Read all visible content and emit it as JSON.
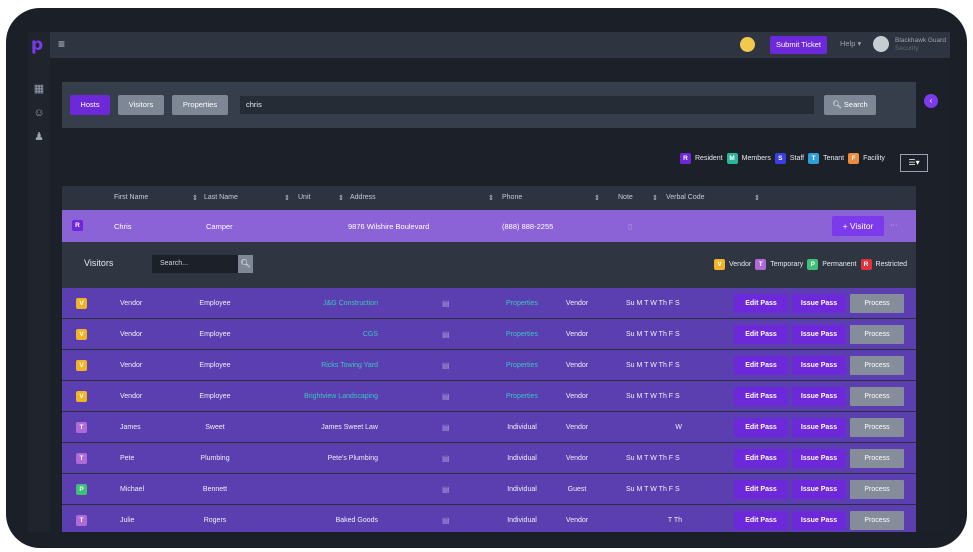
{
  "colors": {
    "accent": "#7c3aed",
    "resident": "#6d28d9",
    "members": "#2bb59a",
    "staff": "#3b3fe0",
    "tenant": "#2f9fd8",
    "facility": "#f08a3c",
    "vendor": "#f0b429",
    "temporary": "#b06ad8",
    "permanent": "#3fbf78",
    "restricted": "#e0323c"
  },
  "topbar": {
    "submit_label": "Submit Ticket",
    "help_label": "Help",
    "user_name": "Blackhawk Guard",
    "user_role": "Security"
  },
  "search": {
    "tabs": [
      "Hosts",
      "Visitors",
      "Properties"
    ],
    "query": "chris",
    "button_label": "Search"
  },
  "legend": [
    {
      "letter": "R",
      "label": "Resident"
    },
    {
      "letter": "M",
      "label": "Members"
    },
    {
      "letter": "S",
      "label": "Staff"
    },
    {
      "letter": "T",
      "label": "Tenant"
    },
    {
      "letter": "F",
      "label": "Facility"
    }
  ],
  "host_columns": [
    "First Name",
    "Last Name",
    "Unit",
    "Address",
    "Phone",
    "Note",
    "Verbal Code"
  ],
  "host": {
    "badge": "R",
    "first": "Chris",
    "last": "Camper",
    "address": "9876 Wilshire Boulevard",
    "phone": "(888) 888-2255",
    "add_label": "+ Visitor",
    "more": "···"
  },
  "visitors_panel": {
    "title": "Visitors",
    "search_placeholder": "Search..."
  },
  "visitor_legend": [
    {
      "letter": "V",
      "label": "Vendor"
    },
    {
      "letter": "T",
      "label": "Temporary"
    },
    {
      "letter": "P",
      "label": "Permanent"
    },
    {
      "letter": "R",
      "label": "Restricted"
    }
  ],
  "visitors": [
    {
      "badge": "V",
      "first": "Vendor",
      "last": "Employee",
      "company": "J&G Construction",
      "linked": true,
      "source": "Properties",
      "type": "Vendor",
      "days": "Su M T W Th F S"
    },
    {
      "badge": "V",
      "first": "Vendor",
      "last": "Employee",
      "company": "CGS",
      "linked": true,
      "source": "Properties",
      "type": "Vendor",
      "days": "Su M T W Th F S"
    },
    {
      "badge": "V",
      "first": "Vendor",
      "last": "Employee",
      "company": "Ricks Towing Yard",
      "linked": true,
      "source": "Properties",
      "type": "Vendor",
      "days": "Su M T W Th F S"
    },
    {
      "badge": "V",
      "first": "Vendor",
      "last": "Employee",
      "company": "Brightview Landscaping",
      "linked": true,
      "source": "Properties",
      "type": "Vendor",
      "days": "Su M T W Th F S"
    },
    {
      "badge": "T",
      "first": "James",
      "last": "Sweet",
      "company": "James Sweet Law",
      "linked": false,
      "source": "Individual",
      "type": "Vendor",
      "days": "W"
    },
    {
      "badge": "T",
      "first": "Pete",
      "last": "Plumbing",
      "company": "Pete's Plumbing",
      "linked": false,
      "source": "Individual",
      "type": "Vendor",
      "days": "Su M T W Th F S"
    },
    {
      "badge": "P",
      "first": "Michael",
      "last": "Bennett",
      "company": "",
      "linked": false,
      "source": "Individual",
      "type": "Guest",
      "days": "Su M T W Th F S"
    },
    {
      "badge": "T",
      "first": "Julie",
      "last": "Rogers",
      "company": "Baked Goods",
      "linked": false,
      "source": "Individual",
      "type": "Vendor",
      "days": "T Th"
    }
  ],
  "actions": {
    "edit": "Edit Pass",
    "issue": "Issue Pass",
    "process": "Process"
  }
}
